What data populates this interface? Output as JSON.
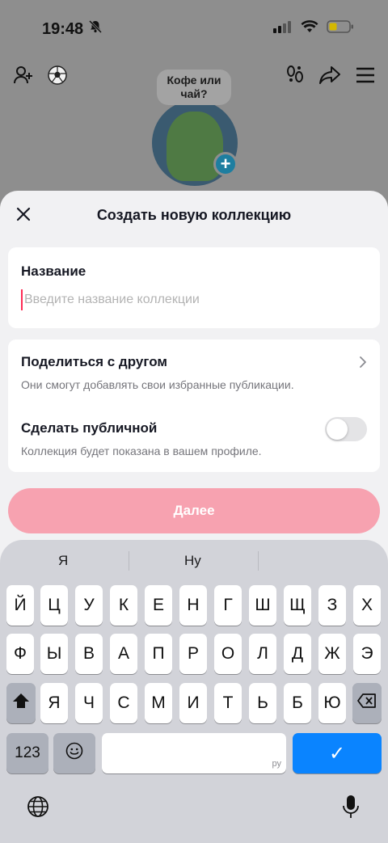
{
  "status_bar": {
    "time": "19:48"
  },
  "profile_bg": {
    "bubble_text": "Кофе или чай?"
  },
  "sheet": {
    "title": "Создать новую коллекцию",
    "name_label": "Название",
    "name_placeholder": "Введите название коллекции",
    "name_value": "",
    "share": {
      "title": "Поделиться с другом",
      "subtitle": "Они смогут добавлять свои избранные публикации."
    },
    "public": {
      "title": "Сделать публичной",
      "subtitle": "Коллекция будет показана в вашем профиле.",
      "enabled": false
    },
    "next_label": "Далее"
  },
  "keyboard": {
    "suggestions": [
      "Я",
      "Ну",
      ""
    ],
    "row1": [
      "Й",
      "Ц",
      "У",
      "К",
      "Е",
      "Н",
      "Г",
      "Ш",
      "Щ",
      "З",
      "Х"
    ],
    "row2": [
      "Ф",
      "Ы",
      "В",
      "А",
      "П",
      "Р",
      "О",
      "Л",
      "Д",
      "Ж",
      "Э"
    ],
    "row3": [
      "Я",
      "Ч",
      "С",
      "М",
      "И",
      "Т",
      "Ь",
      "Б",
      "Ю"
    ],
    "numbers_label": "123",
    "space_lang": "ру",
    "return_symbol": "✓"
  },
  "colors": {
    "accent": "#fe2c55",
    "next_button_disabled": "#f7a2b0",
    "keyboard_return": "#0a84ff"
  },
  "icons": [
    "bell-slash-icon",
    "signal-icon",
    "wifi-icon",
    "battery-icon",
    "add-friend-icon",
    "soccer-ball-icon",
    "footprints-icon",
    "share-icon",
    "menu-icon",
    "close-icon",
    "chevron-right-icon",
    "shift-icon",
    "backspace-icon",
    "emoji-icon",
    "globe-icon",
    "microphone-icon"
  ]
}
